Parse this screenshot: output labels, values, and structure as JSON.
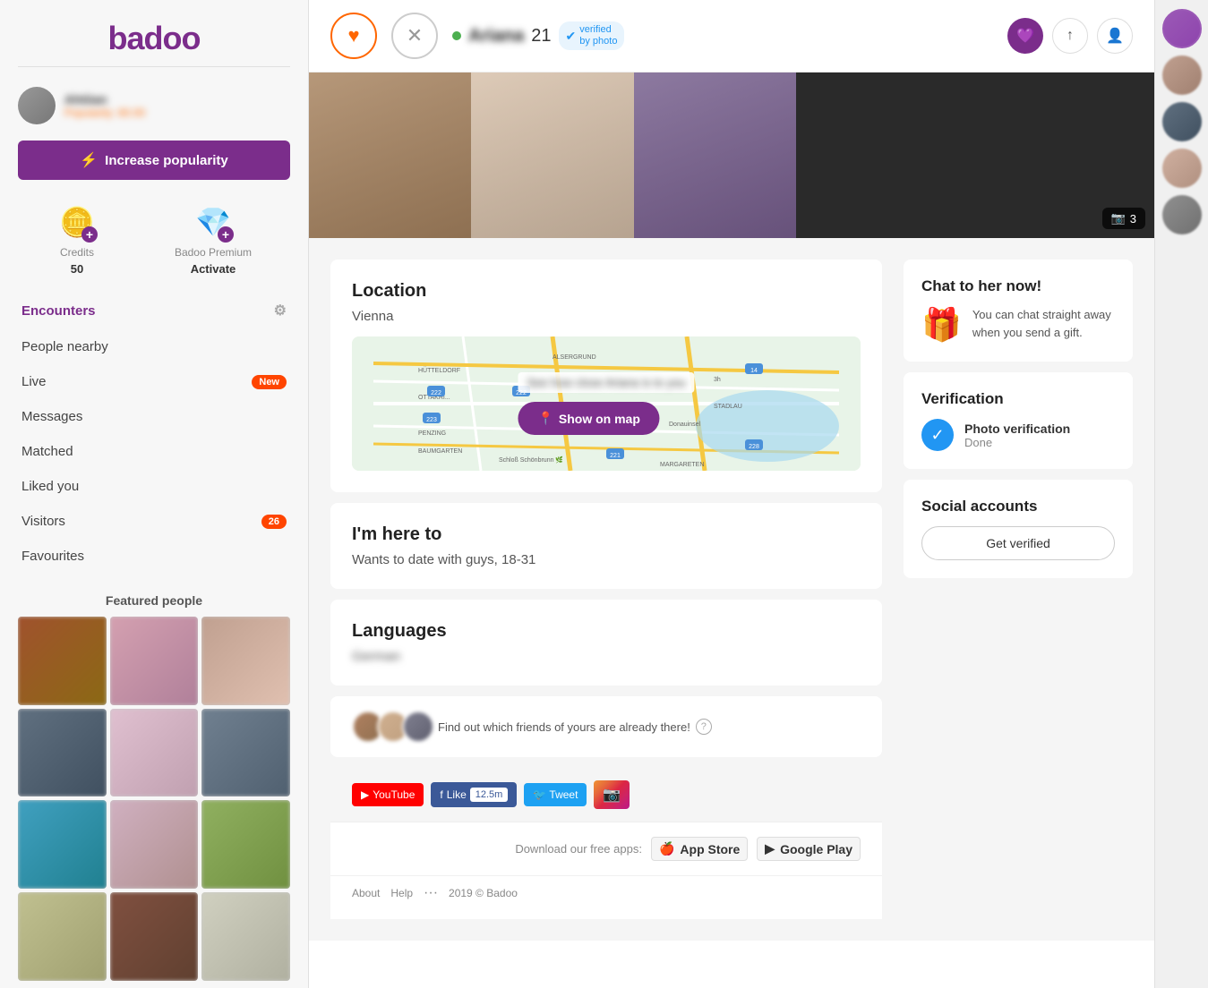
{
  "app": {
    "name": "badoo"
  },
  "sidebar": {
    "logo": "badoo",
    "user": {
      "name": "Ahtiian",
      "popularity": "Popularity: 80.00"
    },
    "increase_popularity_btn": "Increase popularity",
    "credits": {
      "label": "Credits",
      "value": "50",
      "plus": "+"
    },
    "premium": {
      "label": "Badoo Premium",
      "action": "Activate",
      "plus": "+"
    },
    "nav": [
      {
        "id": "encounters",
        "label": "Encounters",
        "active": true,
        "badge": null
      },
      {
        "id": "people-nearby",
        "label": "People nearby",
        "active": false,
        "badge": null
      },
      {
        "id": "live",
        "label": "Live",
        "active": false,
        "badge": "New"
      },
      {
        "id": "messages",
        "label": "Messages",
        "active": false,
        "badge": null
      },
      {
        "id": "matched",
        "label": "Matched",
        "active": false,
        "badge": null
      },
      {
        "id": "liked-you",
        "label": "Liked you",
        "active": false,
        "badge": null
      },
      {
        "id": "visitors",
        "label": "Visitors",
        "active": false,
        "badge": "26"
      },
      {
        "id": "favourites",
        "label": "Favourites",
        "active": false,
        "badge": null
      }
    ],
    "featured": {
      "title": "Featured people"
    }
  },
  "profile": {
    "name": "Ariana",
    "age": "21",
    "online": true,
    "verified": true,
    "verified_label": "verified",
    "verified_sub": "by photo",
    "photos_count": "3",
    "location": {
      "section_title": "Location",
      "city": "Vienna",
      "map_text": "See how close",
      "map_name": "Ariana",
      "map_suffix": "is to you",
      "show_on_map": "Show on map"
    },
    "here_to": {
      "section_title": "I'm here to",
      "text": "Wants to date with guys, 18-31"
    },
    "languages": {
      "section_title": "Languages",
      "value": "German"
    }
  },
  "right_panel": {
    "chat": {
      "title": "Chat to her now!",
      "text": "You can chat straight away when you send a gift."
    },
    "verification": {
      "title": "Verification",
      "label": "Photo verification",
      "status": "Done"
    },
    "social": {
      "title": "Social accounts",
      "btn": "Get verified"
    }
  },
  "footer": {
    "friends_text": "Find out which friends of yours are already there!",
    "social_buttons": {
      "youtube": "YouTube",
      "facebook": "Like",
      "fb_count": "12.5m",
      "twitter": "Tweet",
      "instagram": ""
    },
    "download": {
      "label": "Download our free apps:",
      "app_store": "App Store",
      "google_play": "Google Play"
    },
    "links": {
      "about": "About",
      "help": "Help",
      "more": "···",
      "copyright": "2019 © Badoo"
    }
  }
}
